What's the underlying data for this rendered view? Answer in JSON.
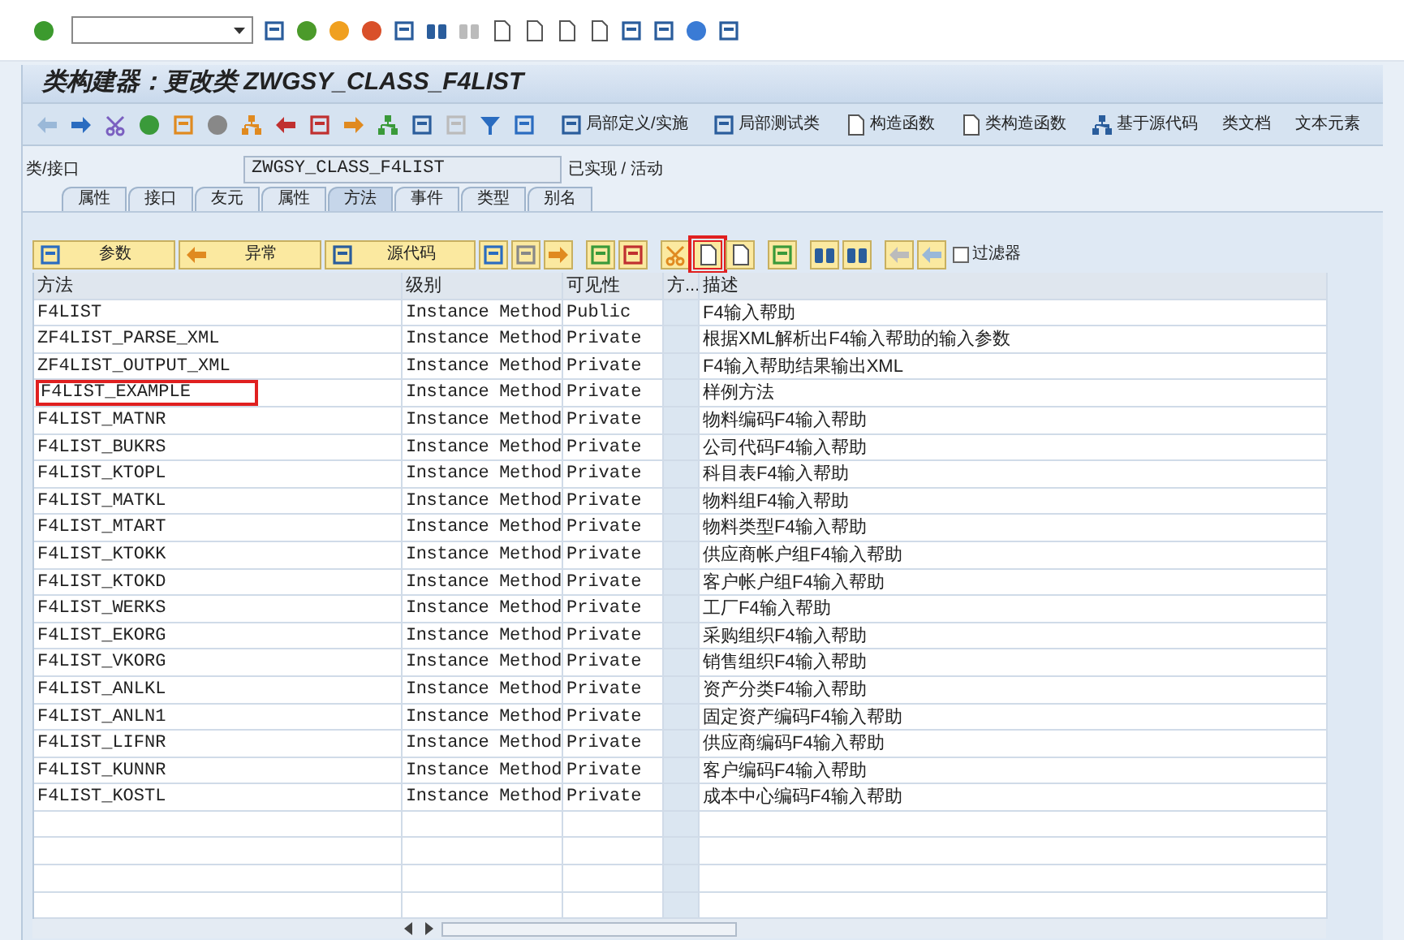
{
  "title": "类构建器：更改类 ZWGSY_CLASS_F4LIST",
  "app_toolbar": {
    "text_buttons": [
      {
        "label": "局部定义/实施",
        "kind": "window"
      },
      {
        "label": "局部测试类",
        "kind": "window"
      },
      {
        "label": "构造函数",
        "kind": "page"
      },
      {
        "label": "类构造函数",
        "kind": "page"
      },
      {
        "label": "基于源代码",
        "kind": "tree"
      },
      {
        "label": "类文档",
        "kind": "plain"
      },
      {
        "label": "文本元素",
        "kind": "plain"
      }
    ]
  },
  "class_field": {
    "label": "类/接口",
    "value": "ZWGSY_CLASS_F4LIST",
    "status": "已实现 / 活动"
  },
  "tabs": [
    {
      "label": "属性",
      "selected": false
    },
    {
      "label": "接口",
      "selected": false
    },
    {
      "label": "友元",
      "selected": false
    },
    {
      "label": "属性",
      "selected": false
    },
    {
      "label": "方法",
      "selected": true
    },
    {
      "label": "事件",
      "selected": false
    },
    {
      "label": "类型",
      "selected": false
    },
    {
      "label": "别名",
      "selected": false
    }
  ],
  "table_toolbar": {
    "text_buttons": [
      {
        "label": "参数",
        "kind": "square"
      },
      {
        "label": "异常",
        "kind": "exception"
      },
      {
        "label": "源代码",
        "kind": "source"
      }
    ],
    "icon_buttons": [
      {
        "kind": "a",
        "highlighted": false
      },
      {
        "kind": "b",
        "highlighted": false
      },
      {
        "kind": "c",
        "highlighted": false
      },
      {
        "kind": "insert",
        "highlighted": false
      },
      {
        "kind": "delete",
        "highlighted": false
      },
      {
        "kind": "cut",
        "highlighted": false
      },
      {
        "kind": "copy",
        "highlighted": true
      },
      {
        "kind": "paste",
        "highlighted": false
      },
      {
        "kind": "stack",
        "highlighted": false
      },
      {
        "kind": "find",
        "highlighted": false
      },
      {
        "kind": "findnext",
        "highlighted": false
      },
      {
        "kind": "pen",
        "highlighted": false
      },
      {
        "kind": "undo",
        "highlighted": false
      }
    ],
    "filter": {
      "label": "过滤器",
      "checked": false
    }
  },
  "table": {
    "columns": [
      "方法",
      "级别",
      "可见性",
      "方...",
      "描述"
    ],
    "rows": [
      {
        "method": "F4LIST",
        "level": "Instance Method",
        "visibility": "Public",
        "description": "F4输入帮助",
        "highlighted": false
      },
      {
        "method": "ZF4LIST_PARSE_XML",
        "level": "Instance Method",
        "visibility": "Private",
        "description": "根据XML解析出F4输入帮助的输入参数",
        "highlighted": false
      },
      {
        "method": "ZF4LIST_OUTPUT_XML",
        "level": "Instance Method",
        "visibility": "Private",
        "description": "F4输入帮助结果输出XML",
        "highlighted": false
      },
      {
        "method": "F4LIST_EXAMPLE",
        "level": "Instance Method",
        "visibility": "Private",
        "description": "样例方法",
        "highlighted": true
      },
      {
        "method": "F4LIST_MATNR",
        "level": "Instance Method",
        "visibility": "Private",
        "description": "物料编码F4输入帮助",
        "highlighted": false
      },
      {
        "method": "F4LIST_BUKRS",
        "level": "Instance Method",
        "visibility": "Private",
        "description": "公司代码F4输入帮助",
        "highlighted": false
      },
      {
        "method": "F4LIST_KTOPL",
        "level": "Instance Method",
        "visibility": "Private",
        "description": "科目表F4输入帮助",
        "highlighted": false
      },
      {
        "method": "F4LIST_MATKL",
        "level": "Instance Method",
        "visibility": "Private",
        "description": "物料组F4输入帮助",
        "highlighted": false
      },
      {
        "method": "F4LIST_MTART",
        "level": "Instance Method",
        "visibility": "Private",
        "description": "物料类型F4输入帮助",
        "highlighted": false
      },
      {
        "method": "F4LIST_KTOKK",
        "level": "Instance Method",
        "visibility": "Private",
        "description": "供应商帐户组F4输入帮助",
        "highlighted": false
      },
      {
        "method": "F4LIST_KTOKD",
        "level": "Instance Method",
        "visibility": "Private",
        "description": "客户帐户组F4输入帮助",
        "highlighted": false
      },
      {
        "method": "F4LIST_WERKS",
        "level": "Instance Method",
        "visibility": "Private",
        "description": "工厂F4输入帮助",
        "highlighted": false
      },
      {
        "method": "F4LIST_EKORG",
        "level": "Instance Method",
        "visibility": "Private",
        "description": "采购组织F4输入帮助",
        "highlighted": false
      },
      {
        "method": "F4LIST_VKORG",
        "level": "Instance Method",
        "visibility": "Private",
        "description": "销售组织F4输入帮助",
        "highlighted": false
      },
      {
        "method": "F4LIST_ANLKL",
        "level": "Instance Method",
        "visibility": "Private",
        "description": "资产分类F4输入帮助",
        "highlighted": false
      },
      {
        "method": "F4LIST_ANLN1",
        "level": "Instance Method",
        "visibility": "Private",
        "description": "固定资产编码F4输入帮助",
        "highlighted": false
      },
      {
        "method": "F4LIST_LIFNR",
        "level": "Instance Method",
        "visibility": "Private",
        "description": "供应商编码F4输入帮助",
        "highlighted": false
      },
      {
        "method": "F4LIST_KUNNR",
        "level": "Instance Method",
        "visibility": "Private",
        "description": "客户编码F4输入帮助",
        "highlighted": false
      },
      {
        "method": "F4LIST_KOSTL",
        "level": "Instance Method",
        "visibility": "Private",
        "description": "成本中心编码F4输入帮助",
        "highlighted": false
      }
    ]
  }
}
